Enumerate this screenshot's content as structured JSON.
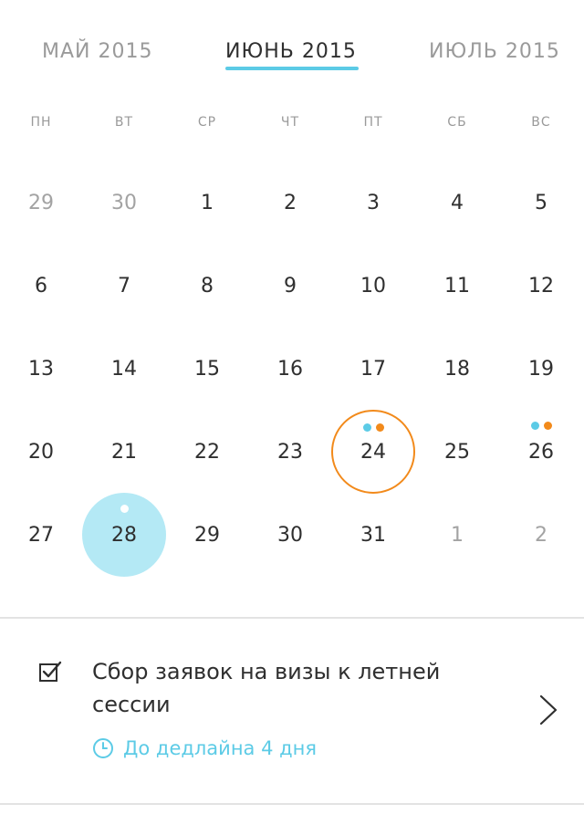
{
  "header": {
    "prev_month": "МАЙ 2015",
    "current_month": "ИЮНЬ 2015",
    "next_month": "ИЮЛЬ 2015",
    "accent_color": "#5ccbe6"
  },
  "weekdays": [
    "ПН",
    "ВТ",
    "СР",
    "ЧТ",
    "ПТ",
    "СБ",
    "ВС"
  ],
  "weeks": [
    [
      {
        "d": "29",
        "muted": true
      },
      {
        "d": "30",
        "muted": true
      },
      {
        "d": "1"
      },
      {
        "d": "2"
      },
      {
        "d": "3"
      },
      {
        "d": "4"
      },
      {
        "d": "5"
      }
    ],
    [
      {
        "d": "6"
      },
      {
        "d": "7"
      },
      {
        "d": "8"
      },
      {
        "d": "9"
      },
      {
        "d": "10"
      },
      {
        "d": "11"
      },
      {
        "d": "12"
      }
    ],
    [
      {
        "d": "13"
      },
      {
        "d": "14"
      },
      {
        "d": "15"
      },
      {
        "d": "16"
      },
      {
        "d": "17"
      },
      {
        "d": "18"
      },
      {
        "d": "19"
      }
    ],
    [
      {
        "d": "20"
      },
      {
        "d": "21"
      },
      {
        "d": "22"
      },
      {
        "d": "23"
      },
      {
        "d": "24",
        "selected": true,
        "dots": [
          "#5ccbe6",
          "#f28a1b"
        ]
      },
      {
        "d": "25"
      },
      {
        "d": "26",
        "dots": [
          "#5ccbe6",
          "#f28a1b"
        ]
      }
    ],
    [
      {
        "d": "27"
      },
      {
        "d": "28",
        "today": true,
        "dots": [
          "#ffffff"
        ]
      },
      {
        "d": "29"
      },
      {
        "d": "30"
      },
      {
        "d": "31"
      },
      {
        "d": "1",
        "muted": true
      },
      {
        "d": "2",
        "muted": true
      }
    ]
  ],
  "colors": {
    "selected_ring": "#f28a1b",
    "today_fill": "#b4e9f5",
    "event_dot_blue": "#5ccbe6",
    "event_dot_orange": "#f28a1b"
  },
  "event": {
    "title": "Сбор заявок на визы к летней сессии",
    "deadline": "До дедлайна 4 дня",
    "icon": "checkbox-icon",
    "deadline_icon": "clock-icon",
    "open_icon": "chevron-right-icon"
  }
}
